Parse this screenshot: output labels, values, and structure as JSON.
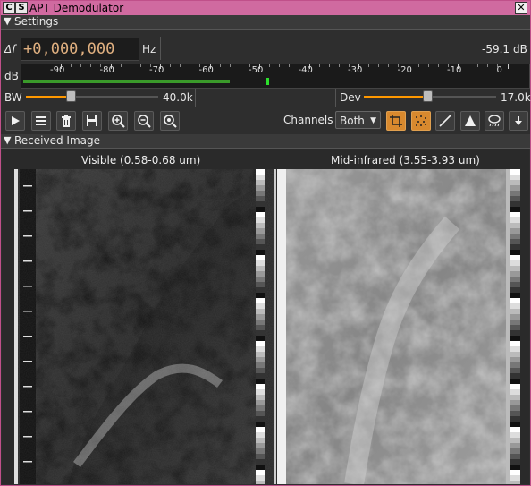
{
  "window": {
    "title": "APT Demodulator",
    "badges": [
      "C",
      "S"
    ]
  },
  "sections": {
    "settings": "Settings",
    "received": "Received Image"
  },
  "settings": {
    "delta_label": "Δf",
    "frequency": "+0,000,000",
    "freq_unit": "Hz",
    "power": "-59.1",
    "power_unit": "dB",
    "db_label": "dB",
    "scale_ticks": [
      "-90",
      "-80",
      "-70",
      "-60",
      "-50",
      "-40",
      "-30",
      "-20",
      "-10",
      "0"
    ],
    "level_bar_fraction": 0.41,
    "peak_fraction": 0.485,
    "bw_label": "BW",
    "bw_value": "40.0k",
    "bw_fraction": 0.33,
    "dev_label": "Dev",
    "dev_value": "17.0k",
    "dev_fraction": 0.47,
    "channels_label": "Channels",
    "channels_selected": "Both"
  },
  "toolbar": {
    "icons": [
      "play-icon",
      "menu-icon",
      "trash-icon",
      "save-icon",
      "zoom-in-icon",
      "zoom-out-icon",
      "zoom-fit-icon",
      "crop-icon",
      "noise-icon",
      "line-icon",
      "histogram-icon",
      "weather-icon",
      "arrow-down-icon"
    ]
  },
  "image": {
    "left_title": "Visible (0.58-0.68 um)",
    "right_title": "Mid-infrared (3.55-3.93 um)"
  },
  "colors": {
    "titlebar": "#d06aa0",
    "accent": "#ff9800",
    "active_button": "#d8892e",
    "level": "#3a9a2a"
  }
}
